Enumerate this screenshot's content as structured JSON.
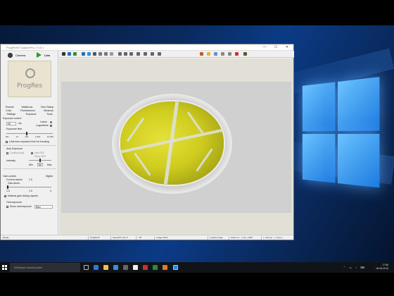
{
  "window": {
    "title": "ProgRes® CapturePro 2.9.0.1",
    "controls": "—  ☐  ✕"
  },
  "camera": {
    "camera_label": "Camera",
    "live_label": "Live",
    "logo_text": "ProgRes"
  },
  "tabs": {
    "row1": [
      "Presets",
      "Multifocus",
      "Time Stamp"
    ],
    "row2": [
      "Color",
      "Fluorescence",
      "Measure"
    ],
    "row3": [
      "Settings",
      "Exposure",
      "Tools"
    ]
  },
  "exposure": {
    "section_label": "Exposure control",
    "value": "20",
    "unit": "ms",
    "linear_label": "Linear",
    "logarithmic_label": "Logarithmic",
    "exposure_time_label": "Exposure time",
    "ticks": [
      "Min",
      "10",
      "100",
      "1,000",
      "10,000"
    ],
    "limit_label": "Limit max exposure time for focusing",
    "auto_label": "Auto Exposure",
    "continuous_label": "Continuously",
    "use_roi_label": "Use ROI",
    "show_roi_label": "Show ROI",
    "intensity_label": "Intensity",
    "intensity_min": "Min",
    "intensity_value": "50",
    "intensity_max": "Max"
  },
  "gain": {
    "section_label": "Gain control",
    "mode": "Digital",
    "current_label": "Current values",
    "current_value": "1.0",
    "factor_label": "Gain factor",
    "factor_min": "1.0",
    "factor_value": "1.0",
    "factor_max": "4",
    "minimal_label": "Minimal gain during capture"
  },
  "overexposure": {
    "section_label": "Overexposure",
    "show_label": "Show overexposure",
    "color": "Red"
  },
  "statusbar": {
    "ready": "Ready",
    "camera": "ProgRes®",
    "speed": "SpeedXT core 5",
    "format": "*.tiff",
    "image_info": "Image 48 bit",
    "loaded": "Loaded image",
    "scale": "Scale 1:1 · x=11, y=867",
    "pixel": "x: 161 µm · y: 20 µm"
  },
  "taskbar": {
    "search_placeholder": "Windows durchsuchen",
    "time": "17:56",
    "date": "06.06.2015"
  }
}
